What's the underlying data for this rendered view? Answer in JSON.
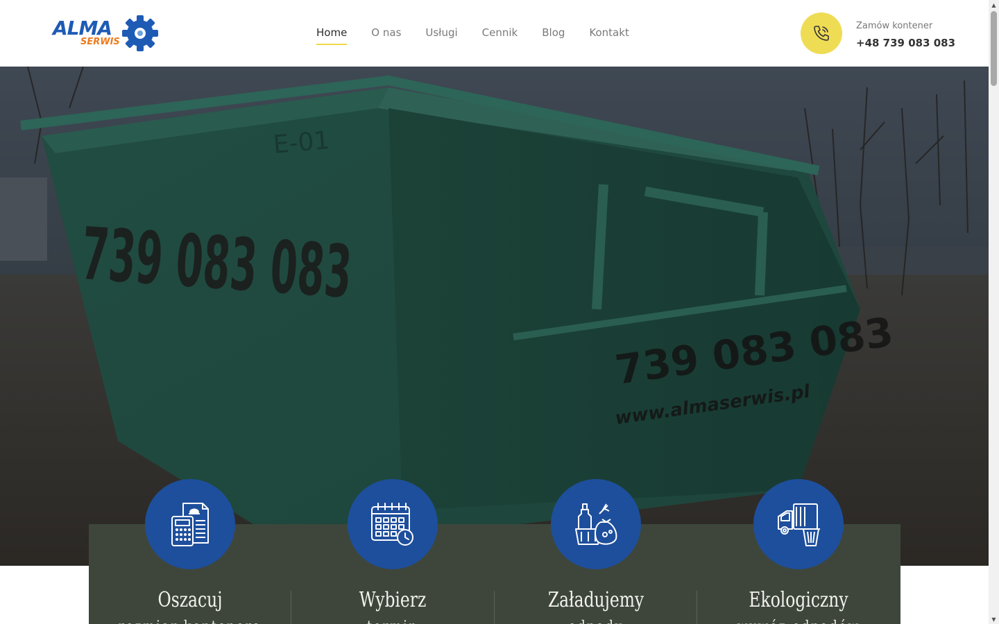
{
  "header": {
    "logo_main": "ALMA",
    "logo_sub": "SERWIS",
    "nav": [
      {
        "label": "Home",
        "active": true
      },
      {
        "label": "O nas",
        "active": false
      },
      {
        "label": "Usługi",
        "active": false
      },
      {
        "label": "Cennik",
        "active": false
      },
      {
        "label": "Blog",
        "active": false
      },
      {
        "label": "Kontakt",
        "active": false
      }
    ],
    "contact_label": "Zamów kontener",
    "contact_phone": "+48 739 083 083"
  },
  "hero": {
    "container_phone": "739 083 083",
    "container_site": "www.almaserwis.pl",
    "container_code": "E-01"
  },
  "features": [
    {
      "title": "Oszacuj",
      "subtitle": "rozmiar kontenera",
      "icon": "calculator-document-icon"
    },
    {
      "title": "Wybierz",
      "subtitle": "termin",
      "icon": "calendar-clock-icon"
    },
    {
      "title": "Załadujemy",
      "subtitle": "odpady",
      "icon": "waste-bags-icon"
    },
    {
      "title": "Ekologiczny",
      "subtitle": "wywóz odpadów",
      "icon": "garbage-truck-icon"
    }
  ],
  "colors": {
    "accent_yellow": "#efdc55",
    "brand_blue": "#1e4f9c",
    "band_green": "#3e463c",
    "logo_orange": "#ee7a1d"
  }
}
